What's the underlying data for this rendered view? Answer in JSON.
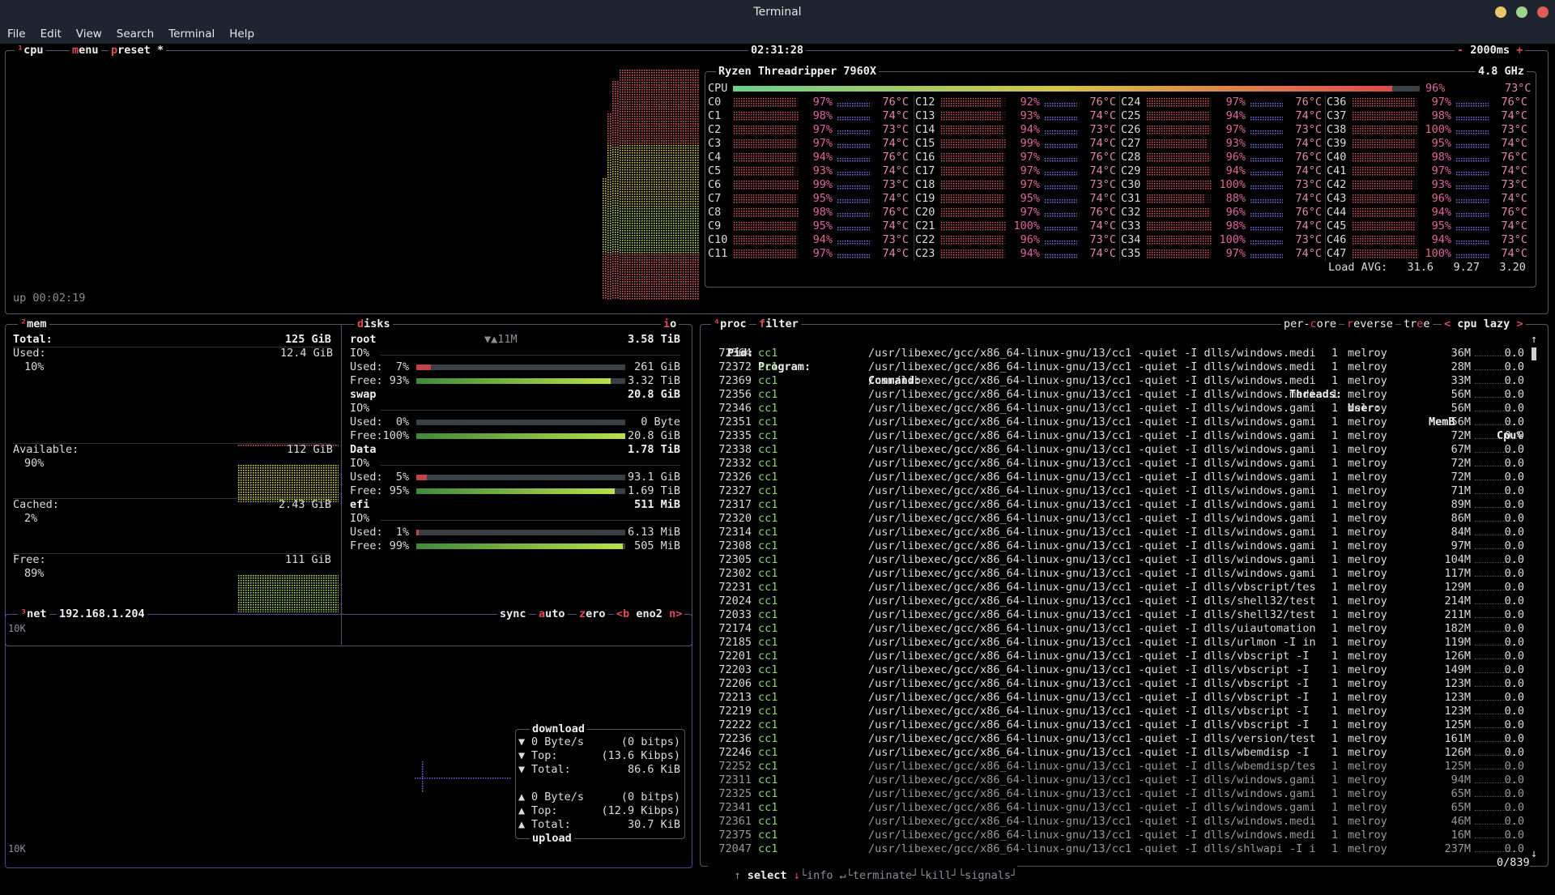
{
  "window": {
    "title": "Terminal"
  },
  "menu": [
    "File",
    "Edit",
    "View",
    "Search",
    "Terminal",
    "Help"
  ],
  "cpu_box": {
    "tabs": [
      "cpu",
      "menu",
      "preset *"
    ],
    "clock": "02:31:28",
    "interval": "2000ms",
    "uptime": "up 00:02:19",
    "model": "Ryzen Threadripper 7960X",
    "freq": "4.8 GHz",
    "total_label": "CPU",
    "total_pct": "96%",
    "total_temp": "73°C",
    "total_value": 96,
    "cores": [
      {
        "n": "C0",
        "p": "97%",
        "t": "76°C"
      },
      {
        "n": "C1",
        "p": "98%",
        "t": "74°C"
      },
      {
        "n": "C2",
        "p": "97%",
        "t": "73°C"
      },
      {
        "n": "C3",
        "p": "97%",
        "t": "74°C"
      },
      {
        "n": "C4",
        "p": "94%",
        "t": "76°C"
      },
      {
        "n": "C5",
        "p": "93%",
        "t": "74°C"
      },
      {
        "n": "C6",
        "p": "99%",
        "t": "73°C"
      },
      {
        "n": "C7",
        "p": "95%",
        "t": "74°C"
      },
      {
        "n": "C8",
        "p": "98%",
        "t": "76°C"
      },
      {
        "n": "C9",
        "p": "95%",
        "t": "74°C"
      },
      {
        "n": "C10",
        "p": "94%",
        "t": "73°C"
      },
      {
        "n": "C11",
        "p": "97%",
        "t": "74°C"
      },
      {
        "n": "C12",
        "p": "92%",
        "t": "76°C"
      },
      {
        "n": "C13",
        "p": "93%",
        "t": "74°C"
      },
      {
        "n": "C14",
        "p": "94%",
        "t": "73°C"
      },
      {
        "n": "C15",
        "p": "99%",
        "t": "74°C"
      },
      {
        "n": "C16",
        "p": "97%",
        "t": "76°C"
      },
      {
        "n": "C17",
        "p": "97%",
        "t": "74°C"
      },
      {
        "n": "C18",
        "p": "97%",
        "t": "73°C"
      },
      {
        "n": "C19",
        "p": "95%",
        "t": "74°C"
      },
      {
        "n": "C20",
        "p": "97%",
        "t": "76°C"
      },
      {
        "n": "C21",
        "p": "100%",
        "t": "74°C"
      },
      {
        "n": "C22",
        "p": "96%",
        "t": "73°C"
      },
      {
        "n": "C23",
        "p": "94%",
        "t": "74°C"
      },
      {
        "n": "C24",
        "p": "97%",
        "t": "76°C"
      },
      {
        "n": "C25",
        "p": "94%",
        "t": "74°C"
      },
      {
        "n": "C26",
        "p": "97%",
        "t": "73°C"
      },
      {
        "n": "C27",
        "p": "93%",
        "t": "74°C"
      },
      {
        "n": "C28",
        "p": "96%",
        "t": "76°C"
      },
      {
        "n": "C29",
        "p": "94%",
        "t": "74°C"
      },
      {
        "n": "C30",
        "p": "100%",
        "t": "73°C"
      },
      {
        "n": "C31",
        "p": "88%",
        "t": "74°C"
      },
      {
        "n": "C32",
        "p": "96%",
        "t": "76°C"
      },
      {
        "n": "C33",
        "p": "98%",
        "t": "74°C"
      },
      {
        "n": "C34",
        "p": "100%",
        "t": "73°C"
      },
      {
        "n": "C35",
        "p": "97%",
        "t": "74°C"
      },
      {
        "n": "C36",
        "p": "97%",
        "t": "76°C"
      },
      {
        "n": "C37",
        "p": "98%",
        "t": "74°C"
      },
      {
        "n": "C38",
        "p": "100%",
        "t": "73°C"
      },
      {
        "n": "C39",
        "p": "95%",
        "t": "74°C"
      },
      {
        "n": "C40",
        "p": "98%",
        "t": "76°C"
      },
      {
        "n": "C41",
        "p": "97%",
        "t": "74°C"
      },
      {
        "n": "C42",
        "p": "93%",
        "t": "73°C"
      },
      {
        "n": "C43",
        "p": "96%",
        "t": "74°C"
      },
      {
        "n": "C44",
        "p": "94%",
        "t": "76°C"
      },
      {
        "n": "C45",
        "p": "95%",
        "t": "74°C"
      },
      {
        "n": "C46",
        "p": "94%",
        "t": "73°C"
      },
      {
        "n": "C47",
        "p": "100%",
        "t": "74°C"
      }
    ],
    "load_label": "Load AVG:",
    "load": [
      "31.6",
      "9.27",
      "3.20"
    ]
  },
  "mem_box": {
    "title": "mem",
    "total_label": "Total:",
    "total": "125 GiB",
    "used_label": "Used:",
    "used": "12.4 GiB",
    "used_pct": "10%",
    "avail_label": "Available:",
    "avail": "112 GiB",
    "avail_pct": "90%",
    "cached_label": "Cached:",
    "cached": "2.43 GiB",
    "cached_pct": "2%",
    "free_label": "Free:",
    "free": "111 GiB",
    "free_pct": "89%"
  },
  "disks_box": {
    "title": "disks",
    "io_tab": "io",
    "io_rate": "▼▲11M",
    "io_label": "IO%",
    "disks": [
      {
        "name": "root",
        "size": "3.58 TiB",
        "used_label": "Used:  7%",
        "used": "261 GiB",
        "free_label": "Free: 93%",
        "free": "3.32 TiB",
        "used_frac": 0.07,
        "free_frac": 0.93
      },
      {
        "name": "swap",
        "size": "20.8 GiB",
        "used_label": "Used:  0%",
        "used": "0 Byte",
        "free_label": "Free:100%",
        "free": "20.8 GiB",
        "used_frac": 0.0,
        "free_frac": 1.0
      },
      {
        "name": "Data",
        "size": "1.78 TiB",
        "used_label": "Used:  5%",
        "used": "93.1 GiB",
        "free_label": "Free: 95%",
        "free": "1.69 TiB",
        "used_frac": 0.05,
        "free_frac": 0.95
      },
      {
        "name": "efi",
        "size": "511 MiB",
        "used_label": "Used:  1%",
        "used": "6.13 MiB",
        "free_label": "Free: 99%",
        "free": "505 MiB",
        "used_frac": 0.01,
        "free_frac": 0.99
      }
    ]
  },
  "net_box": {
    "title": "net",
    "ip": "192.168.1.204",
    "tabs": [
      "sync",
      "auto",
      "zero"
    ],
    "iface_prev": "<b",
    "iface": "eno2",
    "iface_next": "n>",
    "scale_top": "10K",
    "scale_bottom": "10K",
    "download_label": "download",
    "upload_label": "upload",
    "down": [
      {
        "arrow": "▼",
        "label": "0 Byte/s",
        "value": "(0 bitps)"
      },
      {
        "arrow": "▼",
        "label": "Top:",
        "value": "(13.6 Kibps)"
      },
      {
        "arrow": "▼",
        "label": "Total:",
        "value": "86.6 KiB"
      }
    ],
    "up": [
      {
        "arrow": "▲",
        "label": "0 Byte/s",
        "value": "(0 bitps)"
      },
      {
        "arrow": "▲",
        "label": "Top:",
        "value": "(12.9 Kibps)"
      },
      {
        "arrow": "▲",
        "label": "Total:",
        "value": "30.7 KiB"
      }
    ]
  },
  "proc_box": {
    "title": "proc",
    "filter": "filter",
    "options": [
      "per-core",
      "reverse",
      "tree",
      "<",
      "cpu lazy",
      ">"
    ],
    "headers": {
      "pid": "Pid:",
      "program": "Program:",
      "command": "Command:",
      "threads": "Threads:",
      "user": "User:",
      "mem": "MemB",
      "cpu": "Cpu%"
    },
    "rows": [
      [
        "72364",
        "cc1",
        "/usr/libexec/gcc/x86_64-linux-gnu/13/cc1 -quiet -I dlls/windows.medi",
        "1",
        "melroy",
        "36M",
        "0.0"
      ],
      [
        "72372",
        "cc1",
        "/usr/libexec/gcc/x86_64-linux-gnu/13/cc1 -quiet -I dlls/windows.medi",
        "1",
        "melroy",
        "28M",
        "0.0"
      ],
      [
        "72369",
        "cc1",
        "/usr/libexec/gcc/x86_64-linux-gnu/13/cc1 -quiet -I dlls/windows.medi",
        "1",
        "melroy",
        "33M",
        "0.0"
      ],
      [
        "72356",
        "cc1",
        "/usr/libexec/gcc/x86_64-linux-gnu/13/cc1 -quiet -I dlls/windows.medi",
        "1",
        "melroy",
        "56M",
        "0.0"
      ],
      [
        "72346",
        "cc1",
        "/usr/libexec/gcc/x86_64-linux-gnu/13/cc1 -quiet -I dlls/windows.gami",
        "1",
        "melroy",
        "56M",
        "0.0"
      ],
      [
        "72351",
        "cc1",
        "/usr/libexec/gcc/x86_64-linux-gnu/13/cc1 -quiet -I dlls/windows.gami",
        "1",
        "melroy",
        "56M",
        "0.0"
      ],
      [
        "72335",
        "cc1",
        "/usr/libexec/gcc/x86_64-linux-gnu/13/cc1 -quiet -I dlls/windows.gami",
        "1",
        "melroy",
        "72M",
        "0.0"
      ],
      [
        "72338",
        "cc1",
        "/usr/libexec/gcc/x86_64-linux-gnu/13/cc1 -quiet -I dlls/windows.gami",
        "1",
        "melroy",
        "67M",
        "0.0"
      ],
      [
        "72332",
        "cc1",
        "/usr/libexec/gcc/x86_64-linux-gnu/13/cc1 -quiet -I dlls/windows.gami",
        "1",
        "melroy",
        "72M",
        "0.0"
      ],
      [
        "72326",
        "cc1",
        "/usr/libexec/gcc/x86_64-linux-gnu/13/cc1 -quiet -I dlls/windows.gami",
        "1",
        "melroy",
        "72M",
        "0.0"
      ],
      [
        "72327",
        "cc1",
        "/usr/libexec/gcc/x86_64-linux-gnu/13/cc1 -quiet -I dlls/windows.gami",
        "1",
        "melroy",
        "71M",
        "0.0"
      ],
      [
        "72317",
        "cc1",
        "/usr/libexec/gcc/x86_64-linux-gnu/13/cc1 -quiet -I dlls/windows.gami",
        "1",
        "melroy",
        "89M",
        "0.0"
      ],
      [
        "72320",
        "cc1",
        "/usr/libexec/gcc/x86_64-linux-gnu/13/cc1 -quiet -I dlls/windows.gami",
        "1",
        "melroy",
        "86M",
        "0.0"
      ],
      [
        "72314",
        "cc1",
        "/usr/libexec/gcc/x86_64-linux-gnu/13/cc1 -quiet -I dlls/windows.gami",
        "1",
        "melroy",
        "84M",
        "0.0"
      ],
      [
        "72308",
        "cc1",
        "/usr/libexec/gcc/x86_64-linux-gnu/13/cc1 -quiet -I dlls/windows.gami",
        "1",
        "melroy",
        "97M",
        "0.0"
      ],
      [
        "72305",
        "cc1",
        "/usr/libexec/gcc/x86_64-linux-gnu/13/cc1 -quiet -I dlls/windows.gami",
        "1",
        "melroy",
        "104M",
        "0.0"
      ],
      [
        "72302",
        "cc1",
        "/usr/libexec/gcc/x86_64-linux-gnu/13/cc1 -quiet -I dlls/windows.gami",
        "1",
        "melroy",
        "117M",
        "0.0"
      ],
      [
        "72231",
        "cc1",
        "/usr/libexec/gcc/x86_64-linux-gnu/13/cc1 -quiet -I dlls/vbscript/tes",
        "1",
        "melroy",
        "129M",
        "0.0"
      ],
      [
        "72024",
        "cc1",
        "/usr/libexec/gcc/x86_64-linux-gnu/13/cc1 -quiet -I dlls/shell32/test",
        "1",
        "melroy",
        "214M",
        "0.0"
      ],
      [
        "72033",
        "cc1",
        "/usr/libexec/gcc/x86_64-linux-gnu/13/cc1 -quiet -I dlls/shell32/test",
        "1",
        "melroy",
        "211M",
        "0.0"
      ],
      [
        "72174",
        "cc1",
        "/usr/libexec/gcc/x86_64-linux-gnu/13/cc1 -quiet -I dlls/uiautomation",
        "1",
        "melroy",
        "182M",
        "0.0"
      ],
      [
        "72185",
        "cc1",
        "/usr/libexec/gcc/x86_64-linux-gnu/13/cc1 -quiet -I dlls/urlmon -I in",
        "1",
        "melroy",
        "119M",
        "0.0"
      ],
      [
        "72201",
        "cc1",
        "/usr/libexec/gcc/x86_64-linux-gnu/13/cc1 -quiet -I dlls/vbscript -I",
        "1",
        "melroy",
        "126M",
        "0.0"
      ],
      [
        "72203",
        "cc1",
        "/usr/libexec/gcc/x86_64-linux-gnu/13/cc1 -quiet -I dlls/vbscript -I",
        "1",
        "melroy",
        "149M",
        "0.0"
      ],
      [
        "72206",
        "cc1",
        "/usr/libexec/gcc/x86_64-linux-gnu/13/cc1 -quiet -I dlls/vbscript -I",
        "1",
        "melroy",
        "123M",
        "0.0"
      ],
      [
        "72213",
        "cc1",
        "/usr/libexec/gcc/x86_64-linux-gnu/13/cc1 -quiet -I dlls/vbscript -I",
        "1",
        "melroy",
        "123M",
        "0.0"
      ],
      [
        "72219",
        "cc1",
        "/usr/libexec/gcc/x86_64-linux-gnu/13/cc1 -quiet -I dlls/vbscript -I",
        "1",
        "melroy",
        "123M",
        "0.0"
      ],
      [
        "72222",
        "cc1",
        "/usr/libexec/gcc/x86_64-linux-gnu/13/cc1 -quiet -I dlls/vbscript -I",
        "1",
        "melroy",
        "125M",
        "0.0"
      ],
      [
        "72236",
        "cc1",
        "/usr/libexec/gcc/x86_64-linux-gnu/13/cc1 -quiet -I dlls/version/test",
        "1",
        "melroy",
        "161M",
        "0.0"
      ],
      [
        "72246",
        "cc1",
        "/usr/libexec/gcc/x86_64-linux-gnu/13/cc1 -quiet -I dlls/wbemdisp -I",
        "1",
        "melroy",
        "126M",
        "0.0"
      ],
      [
        "72252",
        "cc1",
        "/usr/libexec/gcc/x86_64-linux-gnu/13/cc1 -quiet -I dlls/wbemdisp/tes",
        "1",
        "melroy",
        "125M",
        "0.0"
      ],
      [
        "72311",
        "cc1",
        "/usr/libexec/gcc/x86_64-linux-gnu/13/cc1 -quiet -I dlls/windows.gami",
        "1",
        "melroy",
        "94M",
        "0.0"
      ],
      [
        "72325",
        "cc1",
        "/usr/libexec/gcc/x86_64-linux-gnu/13/cc1 -quiet -I dlls/windows.gami",
        "1",
        "melroy",
        "65M",
        "0.0"
      ],
      [
        "72341",
        "cc1",
        "/usr/libexec/gcc/x86_64-linux-gnu/13/cc1 -quiet -I dlls/windows.gami",
        "1",
        "melroy",
        "65M",
        "0.0"
      ],
      [
        "72361",
        "cc1",
        "/usr/libexec/gcc/x86_64-linux-gnu/13/cc1 -quiet -I dlls/windows.medi",
        "1",
        "melroy",
        "46M",
        "0.0"
      ],
      [
        "72375",
        "cc1",
        "/usr/libexec/gcc/x86_64-linux-gnu/13/cc1 -quiet -I dlls/windows.medi",
        "1",
        "melroy",
        "16M",
        "0.0"
      ],
      [
        "72047",
        "cc1",
        "/usr/libexec/gcc/x86_64-linux-gnu/13/cc1 -quiet -I dlls/shlwapi -I i",
        "1",
        "melroy",
        "237M",
        "0.0"
      ]
    ],
    "footer": {
      "select": "select",
      "info": "info",
      "terminate": "terminate",
      "kill": "kill",
      "signals": "signals",
      "count": "0/839"
    }
  },
  "colors": {
    "accent": "#e04a5a",
    "border": "#505a66",
    "mem_graph": "#d6d04a",
    "free_graph": "#a9d65a",
    "core_graph": "#d4525a",
    "temp_graph": "#7a6ae0",
    "net_graph": "#8a5ae0"
  }
}
